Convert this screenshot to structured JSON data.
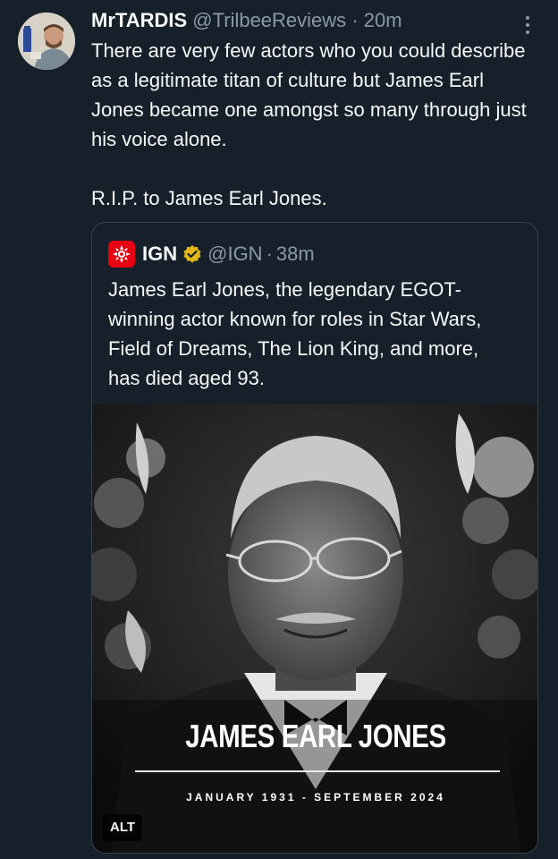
{
  "tweet": {
    "author_name": "MrTARDIS",
    "author_handle": "@TrilbeeReviews",
    "separator": "·",
    "time": "20m",
    "text": "There are very few actors who you could describe as a legitimate titan of culture but James Earl Jones became one amongst so many through just his voice alone.\n\nR.I.P. to James Earl Jones.",
    "more_icon": "more-vertical-icon"
  },
  "quoted": {
    "author_name": "IGN",
    "author_handle": "@IGN",
    "separator": "·",
    "time": "38m",
    "verified_icon": "verified-badge-icon",
    "verified_color": "#e2b719",
    "logo_color": "#e60012",
    "text": "James Earl Jones, the legendary EGOT-winning actor known for roles in Star Wars, Field of Dreams, The Lion King, and more, has died aged 93.",
    "media": {
      "headline": "JAMES EARL JONES",
      "dates": "JANUARY 1931 - SEPTEMBER 2024",
      "alt_label": "ALT"
    }
  },
  "colors": {
    "background": "#15202b",
    "text_primary": "#f7f9f9",
    "text_secondary": "#8b98a5",
    "border": "#38444d"
  }
}
